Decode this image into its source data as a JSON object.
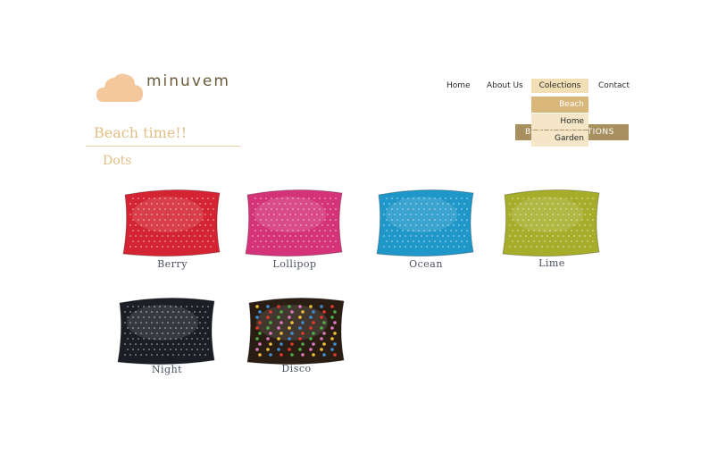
{
  "brand": {
    "name": "minuvem",
    "logo_icon": "cloud-icon"
  },
  "nav": {
    "items": [
      {
        "label": "Home"
      },
      {
        "label": "About Us"
      },
      {
        "label": "Colections",
        "active": true
      },
      {
        "label": "Contact"
      }
    ],
    "dropdown": [
      {
        "label": "Beach",
        "selected": true
      },
      {
        "label": "Home"
      },
      {
        "label": "Garden"
      }
    ],
    "banner_label": "BEACH COLECTIONS"
  },
  "main": {
    "title": "Beach time!!",
    "subtitle": "Dots"
  },
  "products": [
    {
      "name": "Berry",
      "color": "#d42433"
    },
    {
      "name": "Lollipop",
      "color": "#d4337a"
    },
    {
      "name": "Ocean",
      "color": "#1f97c8"
    },
    {
      "name": "Lime",
      "color": "#a5ad2a"
    },
    {
      "name": "Night",
      "color": "#1c1e26"
    },
    {
      "name": "Disco",
      "color": "#2a1d14"
    }
  ],
  "colors": {
    "accent": "#e0bf86",
    "nav_active": "#f2dfb6",
    "banner": "#a89060",
    "logo_cloud": "#f4c79c"
  }
}
